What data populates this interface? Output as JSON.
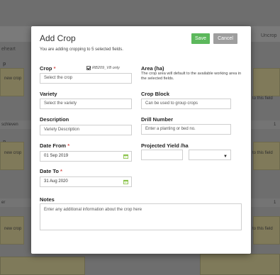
{
  "background": {
    "headers": {
      "left": "eheart",
      "right": "Uncrop"
    },
    "rows": [
      {
        "label": "p",
        "cell": "new crop",
        "right": "to this field"
      },
      {
        "strip": "schleven",
        "right_strip": "1",
        "label": "p",
        "cell": "new crop",
        "right": "to this field"
      },
      {
        "strip": "er",
        "right_strip": "1",
        "label": "p",
        "cell": "new crop",
        "right": "to this field"
      }
    ]
  },
  "modal": {
    "title": "Add Crop",
    "subtitle": "You are adding cropping to 5 selected fields.",
    "save_label": "Save",
    "cancel_label": "Cancel",
    "crop": {
      "label": "Crop",
      "required": "*",
      "checkbox_label": "RB209_V8 only",
      "placeholder": "Select the crop"
    },
    "area": {
      "label": "Area (ha)",
      "help": "The crop area will default to the available working area in the selected fields."
    },
    "variety": {
      "label": "Variety",
      "placeholder": "Select the variety"
    },
    "crop_block": {
      "label": "Crop Block",
      "placeholder": "Can be used to group crops"
    },
    "description": {
      "label": "Description",
      "placeholder": "Variety Description"
    },
    "drill_number": {
      "label": "Drill Number",
      "placeholder": "Enter a planting or bed no."
    },
    "date_from": {
      "label": "Date From",
      "required": "*",
      "value": "01 Sep 2019"
    },
    "projected_yield": {
      "label": "Projected Yield /ha",
      "value": "",
      "unit": ""
    },
    "date_to": {
      "label": "Date To",
      "required": "*",
      "value": "31 Aug 2020"
    },
    "notes": {
      "label": "Notes",
      "placeholder": "Enter any additional information about the crop here"
    }
  },
  "colors": {
    "save": "#5cb85c",
    "cancel": "#9e9e9e",
    "required": "#d9534f"
  }
}
